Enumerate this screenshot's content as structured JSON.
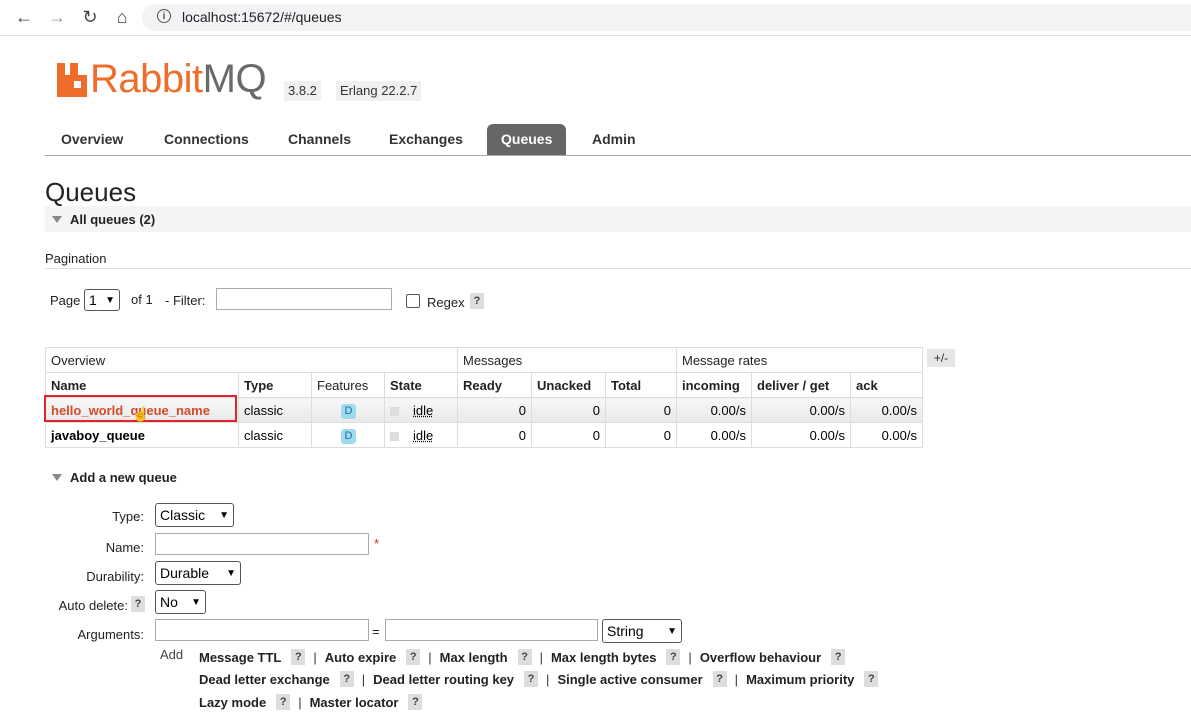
{
  "browser": {
    "url": "localhost:15672/#/queues"
  },
  "brand": {
    "logo_rabbit": "Rabbit",
    "logo_mq": "MQ",
    "version": "3.8.2",
    "erlang": "Erlang 22.2.7",
    "accent": "#ef6d2b"
  },
  "nav": {
    "tabs": [
      "Overview",
      "Connections",
      "Channels",
      "Exchanges",
      "Queues",
      "Admin"
    ],
    "active": "Queues"
  },
  "page": {
    "title": "Queues",
    "all_queues_label": "All queues (2)",
    "pagination_label": "Pagination",
    "page_label": "Page",
    "page_value": "1",
    "of_label": "of 1",
    "filter_label": "- Filter:",
    "filter_value": "",
    "regex_label": "Regex",
    "help": "?"
  },
  "table": {
    "group_headers": [
      "Overview",
      "Messages",
      "Message rates"
    ],
    "columns": [
      "Name",
      "Type",
      "Features",
      "State",
      "Ready",
      "Unacked",
      "Total",
      "incoming",
      "deliver / get",
      "ack"
    ],
    "toggle": "+/-",
    "rows": [
      {
        "name": "hello_world_queue_name",
        "type": "classic",
        "features": "D",
        "state": "idle",
        "ready": "0",
        "unacked": "0",
        "total": "0",
        "incoming": "0.00/s",
        "deliver_get": "0.00/s",
        "ack": "0.00/s"
      },
      {
        "name": "javaboy_queue",
        "type": "classic",
        "features": "D",
        "state": "idle",
        "ready": "0",
        "unacked": "0",
        "total": "0",
        "incoming": "0.00/s",
        "deliver_get": "0.00/s",
        "ack": "0.00/s"
      }
    ]
  },
  "add_queue": {
    "title": "Add a new queue",
    "type_label": "Type:",
    "type_value": "Classic",
    "name_label": "Name:",
    "name_value": "",
    "required_mark": "*",
    "durability_label": "Durability:",
    "durability_value": "Durable",
    "auto_delete_label": "Auto delete:",
    "auto_delete_value": "No",
    "arguments_label": "Arguments:",
    "equals": "=",
    "arg_type_value": "String",
    "add_label": "Add",
    "arg_shortcuts": [
      "Message TTL",
      "Auto expire",
      "Max length",
      "Max length bytes",
      "Overflow behaviour",
      "Dead letter exchange",
      "Dead letter routing key",
      "Single active consumer",
      "Maximum priority",
      "Lazy mode",
      "Master locator"
    ],
    "separator": "|"
  }
}
